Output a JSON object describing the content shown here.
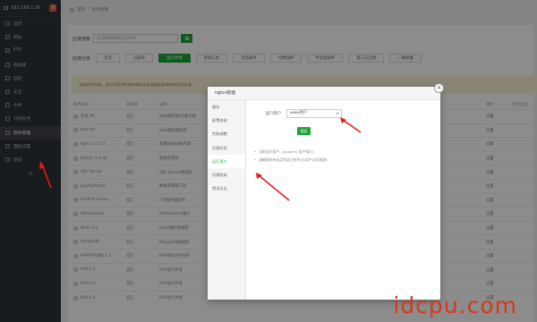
{
  "sidebar": {
    "ip": "192.168.1.20",
    "badge": "0",
    "items": [
      {
        "label": "首页"
      },
      {
        "label": "网站"
      },
      {
        "label": "FTP"
      },
      {
        "label": "数据库"
      },
      {
        "label": "监控"
      },
      {
        "label": "安全"
      },
      {
        "label": "文件"
      },
      {
        "label": "计划任务"
      },
      {
        "label": "软件管理"
      },
      {
        "label": "面板设置"
      },
      {
        "label": "退出"
      }
    ],
    "add_label": "+"
  },
  "breadcrumb": {
    "home": "首页",
    "sep": "/",
    "current": "软件管理"
  },
  "search": {
    "label": "应用搜索",
    "placeholder": "支持模糊搜索应用名称"
  },
  "categories": {
    "label": "应用分类",
    "items": [
      "全部",
      "已安装",
      "运行环境",
      "系统工具",
      "宝塔插件",
      "付费插件",
      "专业版插件",
      "第三方应用",
      "一键部署"
    ]
  },
  "notice": "当前软件列表，运行环境中的软件请前往宝塔面板安装相关运行环境。",
  "table": {
    "headers": [
      "软件名称",
      "开发商",
      "说明",
      "",
      "操作",
      "首页显示"
    ],
    "rows": [
      {
        "name": "宝塔_PE",
        "dev": "官方",
        "desc": "Web服务器/负载均衡",
        "op": "设置"
      },
      {
        "name": "Apache",
        "dev": "官方",
        "desc": "Web服务器软件",
        "op": "设置"
      },
      {
        "name": "Nginx 1.17.2",
        "dev": "官方",
        "desc": "轻量级Web服务器",
        "op": "设置"
      },
      {
        "name": "MySQL 5.6.44",
        "dev": "官方",
        "desc": "数据库服务",
        "op": "设置"
      },
      {
        "name": "SQL Server",
        "dev": "官方",
        "desc": "SQL Server数据库",
        "op": "设置"
      },
      {
        "name": "phpMyAdmin",
        "dev": "官方",
        "desc": "数据库管理工具",
        "op": "设置"
      },
      {
        "name": "FileZilla Server",
        "dev": "官方",
        "desc": "FTP服务器软件",
        "op": "设置"
      },
      {
        "name": "Memcached",
        "dev": "官方",
        "desc": "Memcached缓存",
        "op": "设置"
      },
      {
        "name": "Redis 5.0",
        "dev": "官方",
        "desc": "Redis缓存数据库",
        "op": "设置"
      },
      {
        "name": "MongoDB",
        "dev": "官方",
        "desc": "MongoDB数据库",
        "op": "设置"
      },
      {
        "name": "PHP守护进程 1.2",
        "dev": "官方",
        "desc": "PHP进程守护程序",
        "op": "设置"
      },
      {
        "name": "PHP-5.2",
        "dev": "官方",
        "desc": "PHP运行环境",
        "op": "设置"
      },
      {
        "name": "PHP-5.3",
        "dev": "官方",
        "desc": "PHP运行环境",
        "op": "设置"
      },
      {
        "name": "PHP-5.4",
        "dev": "官方",
        "desc": "PHP运行环境",
        "op": "设置"
      }
    ]
  },
  "modal": {
    "title": "nginx管理",
    "close": "×",
    "menu": [
      "服务",
      "配置修改",
      "性能调整",
      "负载状态",
      "运行用户",
      "切换版本",
      "错误日志"
    ],
    "active_index": 4,
    "field_label": "运行用户",
    "select_value": "www用户",
    "save_label": "保存",
    "tips": [
      "当前运行用户：[system] 用户组[0]",
      "请确保所有站点目录已授予[IIS用户]访问权限"
    ]
  },
  "watermark": "idcpu.com",
  "colors": {
    "accent": "#20a53a",
    "sidebar": "#2f3338",
    "annotation": "#e0201d"
  }
}
